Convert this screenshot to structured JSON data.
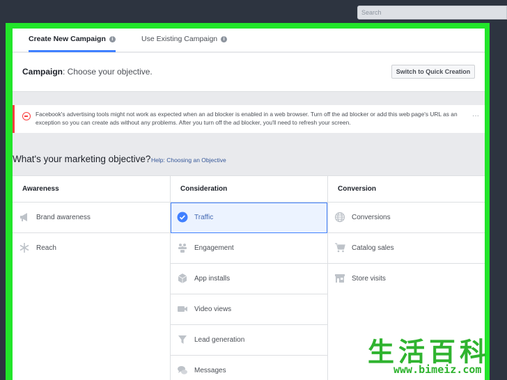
{
  "search": {
    "placeholder": "Search"
  },
  "tabs": [
    {
      "label": "Create New Campaign",
      "active": true
    },
    {
      "label": "Use Existing Campaign",
      "active": false
    }
  ],
  "campaign": {
    "title": "Campaign",
    "subtitle": ": Choose your objective.",
    "quick_button": "Switch to Quick Creation"
  },
  "alert": {
    "text": "Facebook's advertising tools might not work as expected when an ad blocker is enabled in a web browser. Turn off the ad blocker or add this web page's URL as an exception so you can create ads without any problems. After you turn off the ad blocker, you'll need to refresh your screen.",
    "more": "···"
  },
  "objective": {
    "heading": "What's your marketing objective?",
    "help_link": "Help: Choosing an Objective"
  },
  "columns": [
    {
      "header": "Awareness",
      "items": [
        {
          "label": "Brand awareness",
          "icon": "megaphone-icon"
        },
        {
          "label": "Reach",
          "icon": "asterisk-icon"
        }
      ]
    },
    {
      "header": "Consideration",
      "items": [
        {
          "label": "Traffic",
          "icon": "check-circle-icon",
          "selected": true
        },
        {
          "label": "Engagement",
          "icon": "people-icon"
        },
        {
          "label": "App installs",
          "icon": "cube-icon"
        },
        {
          "label": "Video views",
          "icon": "video-camera-icon"
        },
        {
          "label": "Lead generation",
          "icon": "funnel-icon"
        },
        {
          "label": "Messages",
          "icon": "chat-bubbles-icon"
        }
      ]
    },
    {
      "header": "Conversion",
      "items": [
        {
          "label": "Conversions",
          "icon": "globe-icon"
        },
        {
          "label": "Catalog sales",
          "icon": "shopping-cart-icon"
        },
        {
          "label": "Store visits",
          "icon": "store-icon"
        }
      ]
    }
  ],
  "colors": {
    "frame": "#22e52a",
    "accent": "#4080ff",
    "alert": "#fa3e3e",
    "link": "#365899"
  },
  "watermark": {
    "text": "生活百科",
    "url": "www.bimeiz.com"
  }
}
